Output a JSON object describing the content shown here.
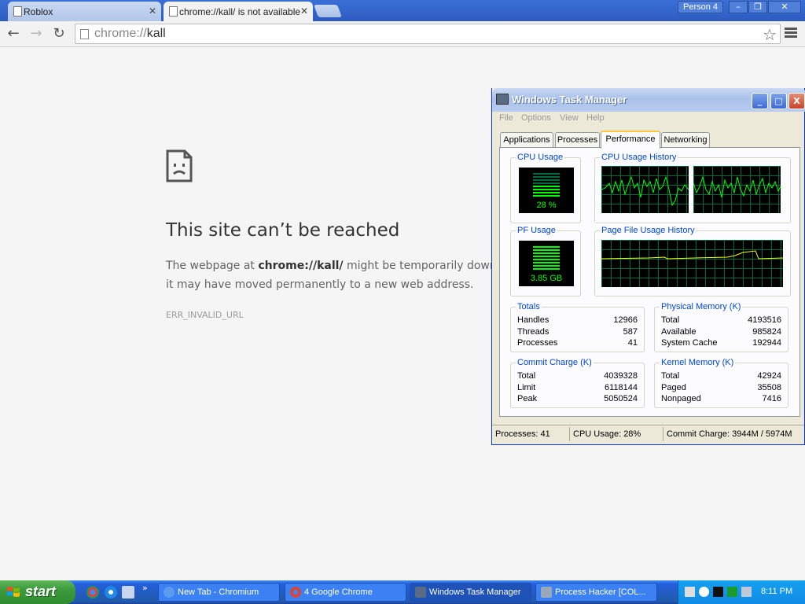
{
  "browser": {
    "tabs": [
      {
        "title": "Roblox",
        "active": false
      },
      {
        "title": "chrome://kall/ is not available",
        "active": true
      }
    ],
    "profile_label": "Person 4",
    "window_controls": {
      "minimize": "–",
      "restore": "❐",
      "close": "✕"
    },
    "nav": {
      "back": "←",
      "forward": "→",
      "reload": "↻"
    },
    "omnibox": {
      "scheme": "chrome://",
      "host": "kall"
    },
    "star": "☆"
  },
  "error_page": {
    "title": "This site can’t be reached",
    "body_prefix": "The webpage at ",
    "body_url": "chrome://kall/",
    "body_suffix": " might be temporarily down or it may have moved permanently to a new web address.",
    "code": "ERR_INVALID_URL"
  },
  "task_manager": {
    "title": "Windows Task Manager",
    "controls": {
      "minimize": "_",
      "maximize": "□",
      "close": "X"
    },
    "menu": [
      "File",
      "Options",
      "View",
      "Help"
    ],
    "tabs": [
      "Applications",
      "Processes",
      "Performance",
      "Networking"
    ],
    "selected_tab": "Performance",
    "cpu_usage": {
      "label": "CPU Usage",
      "value": "28 %",
      "percent": 28
    },
    "cpu_history": {
      "label": "CPU Usage History"
    },
    "pf_usage": {
      "label": "PF Usage",
      "value": "3.85 GB"
    },
    "pf_history": {
      "label": "Page File Usage History"
    },
    "totals": {
      "label": "Totals",
      "rows": [
        {
          "k": "Handles",
          "v": "12966"
        },
        {
          "k": "Threads",
          "v": "587"
        },
        {
          "k": "Processes",
          "v": "41"
        }
      ]
    },
    "physical_memory": {
      "label": "Physical Memory (K)",
      "rows": [
        {
          "k": "Total",
          "v": "4193516"
        },
        {
          "k": "Available",
          "v": "985824"
        },
        {
          "k": "System Cache",
          "v": "192944"
        }
      ]
    },
    "commit_charge": {
      "label": "Commit Charge (K)",
      "rows": [
        {
          "k": "Total",
          "v": "4039328"
        },
        {
          "k": "Limit",
          "v": "6118144"
        },
        {
          "k": "Peak",
          "v": "5050524"
        }
      ]
    },
    "kernel_memory": {
      "label": "Kernel Memory (K)",
      "rows": [
        {
          "k": "Total",
          "v": "42924"
        },
        {
          "k": "Paged",
          "v": "35508"
        },
        {
          "k": "Nonpaged",
          "v": "7416"
        }
      ]
    },
    "status": {
      "processes": "Processes: 41",
      "cpu": "CPU Usage: 28%",
      "commit": "Commit Charge: 3944M / 5974M"
    }
  },
  "taskbar": {
    "start_label": "start",
    "more": "»",
    "tasks": [
      {
        "label": "New Tab - Chromium",
        "icon": "chromium-icon"
      },
      {
        "label": "4 Google Chrome",
        "icon": "chrome-icon"
      },
      {
        "label": "Windows Task Manager",
        "icon": "task-manager-icon"
      },
      {
        "label": "Process Hacker [COL...",
        "icon": "process-hacker-icon"
      }
    ],
    "clock": "8:11 PM"
  },
  "colors": {
    "xp_blue": "#245edc",
    "graph_green": "#00ff00",
    "grid_green": "#006b3f",
    "start_green": "#3c9a3c"
  }
}
